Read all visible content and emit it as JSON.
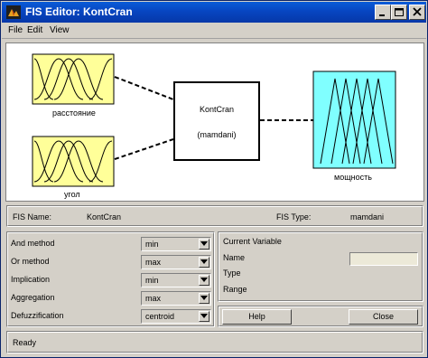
{
  "window": {
    "title": "FIS Editor: KontCran"
  },
  "menu": [
    "File",
    "Edit",
    "View"
  ],
  "diagram": {
    "inputs": [
      {
        "name": "расстояние",
        "fill": "#ffff99"
      },
      {
        "name": "угол",
        "fill": "#ffff99"
      }
    ],
    "system": {
      "name": "KontCran",
      "type": "(mamdani)"
    },
    "output": {
      "name": "мощность",
      "fill": "#80ffff"
    }
  },
  "fis_info": {
    "name_label": "FIS Name:",
    "name_value": "KontCran",
    "type_label": "FIS Type:",
    "type_value": "mamdani"
  },
  "methods": [
    {
      "label": "And method",
      "value": "min"
    },
    {
      "label": "Or method",
      "value": "max"
    },
    {
      "label": "Implication",
      "value": "min"
    },
    {
      "label": "Aggregation",
      "value": "max"
    },
    {
      "label": "Defuzzification",
      "value": "centroid"
    }
  ],
  "current_variable": {
    "heading": "Current Variable",
    "name_label": "Name",
    "type_label": "Type",
    "range_label": "Range",
    "name_value": ""
  },
  "buttons": {
    "help": "Help",
    "close": "Close"
  },
  "status": "Ready",
  "colors": {
    "titlebar": "#0745c1",
    "input_mf_fill": "#ffff99",
    "output_mf_fill": "#80ffff",
    "panel_bg": "#d4d0c8"
  }
}
